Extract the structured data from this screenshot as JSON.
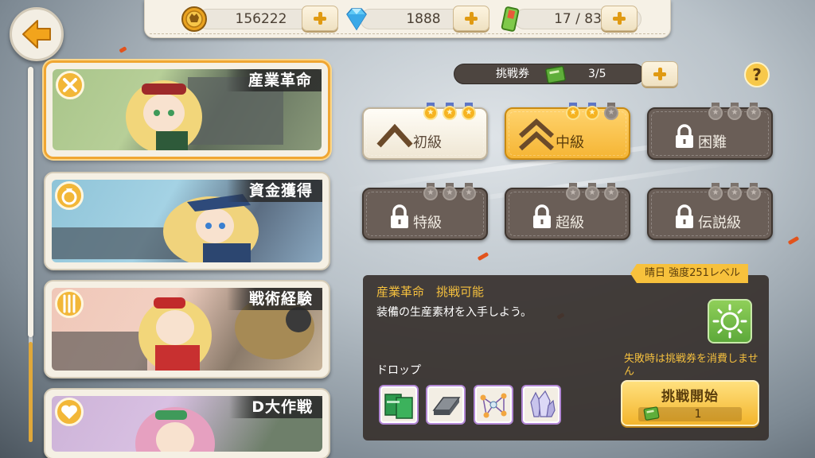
{
  "resources": {
    "coins": "156222",
    "gems": "1888",
    "stamina": "17 / 83"
  },
  "stages": [
    {
      "label": "産業革命",
      "icon": "tools-icon"
    },
    {
      "label": "資金獲得",
      "icon": "money-bag-icon"
    },
    {
      "label": "戦術経験",
      "icon": "cutlery-icon"
    },
    {
      "label": "D大作戦",
      "icon": "heart-icon"
    }
  ],
  "tickets": {
    "label": "挑戦券",
    "value": "3/5"
  },
  "help_label": "?",
  "difficulties": [
    {
      "name": "初級",
      "state": "cleared",
      "medals": 3
    },
    {
      "name": "中級",
      "state": "current",
      "medals": 2
    },
    {
      "name": "困難",
      "state": "locked",
      "medals": 0
    },
    {
      "name": "特級",
      "state": "locked",
      "medals": 0
    },
    {
      "name": "超級",
      "state": "locked",
      "medals": 0
    },
    {
      "name": "伝説級",
      "state": "locked",
      "medals": 0
    }
  ],
  "panel": {
    "weather": "晴日 強度251レベル",
    "title": "産業革命　挑戦可能",
    "description": "装備の生産素材を入手しよう。",
    "fail_note": "失敗時は挑戦券を消費しません",
    "drop_label": "ドロップ",
    "drops": [
      "green-crate-icon",
      "steel-plate-icon",
      "circuit-icon",
      "crystal-icon"
    ],
    "start_label": "挑戦開始",
    "start_cost": "1"
  },
  "colors": {
    "accent": "#f3b52c",
    "panel": "#38322e",
    "highlight_text": "#f5c03e"
  }
}
